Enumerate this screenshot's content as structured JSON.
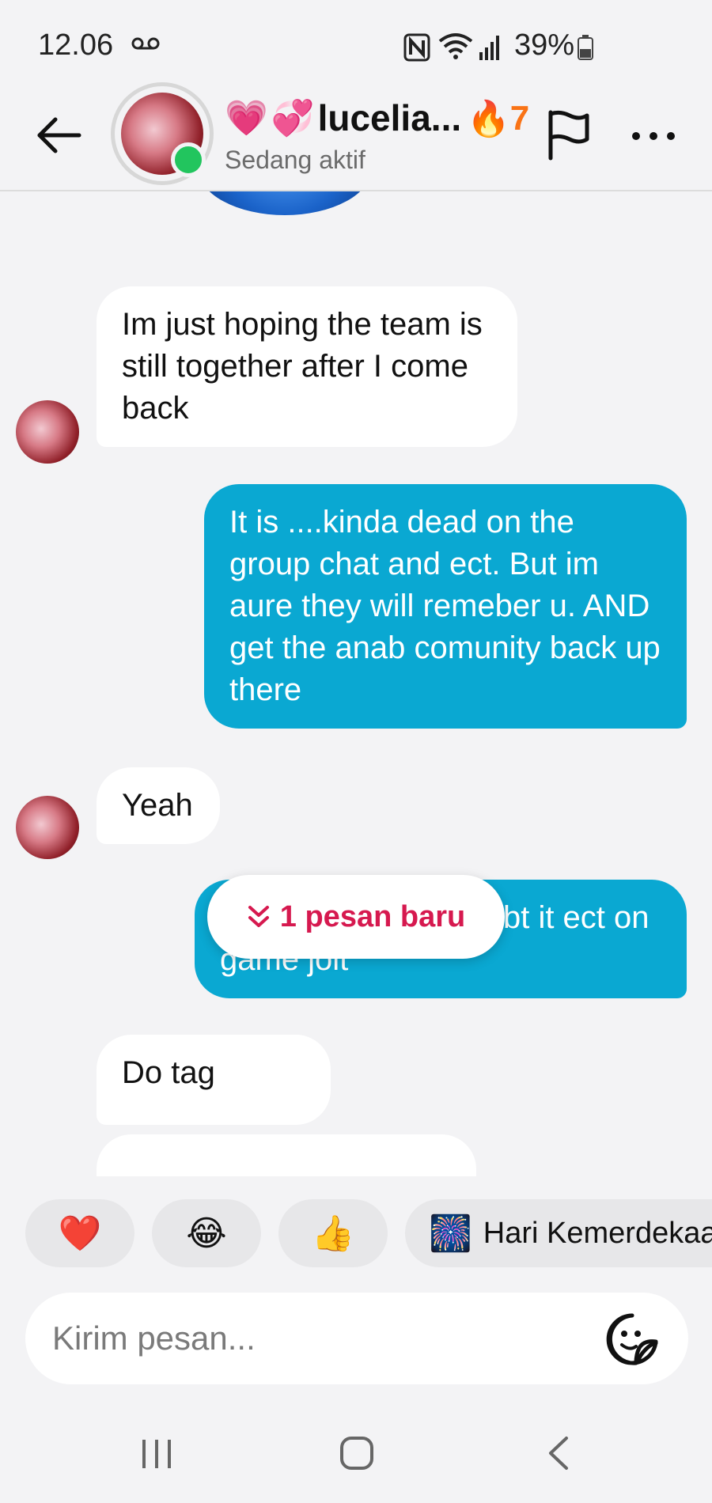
{
  "status_bar": {
    "time": "12.06",
    "battery": "39%",
    "icons": [
      "voicemail-icon",
      "nfc-icon",
      "wifi-icon",
      "signal-icon",
      "battery-icon"
    ]
  },
  "header": {
    "name": "lucelia...",
    "name_emojis": [
      "💗",
      "💞"
    ],
    "streak_icon": "🔥",
    "streak_count": "7",
    "status": "Sedang aktif",
    "icons": [
      "back-arrow-icon",
      "flag-icon",
      "more-icon"
    ]
  },
  "messages": [
    {
      "direction": "in",
      "text": "Im just hoping the team is still together after I come back"
    },
    {
      "direction": "out",
      "text": "It is ....kinda dead on the group chat and ect. But im aure they will remeber u. AND get the anab comunity back up there"
    },
    {
      "direction": "in",
      "text": "Yeah"
    },
    {
      "direction": "out",
      "text": ":3 i can try posting abt it ect on game jolt"
    },
    {
      "direction": "in",
      "text": "Do tag"
    }
  ],
  "new_message_pill": {
    "icon": "double-chevron-down-icon",
    "label": "1 pesan baru",
    "color": "#d6194f"
  },
  "quick_reactions": [
    {
      "emoji": "❤️"
    },
    {
      "emoji": "😂"
    },
    {
      "emoji": "👍"
    },
    {
      "emoji": "🎆",
      "label": "Hari Kemerdekaa"
    }
  ],
  "composer": {
    "placeholder": "Kirim pesan...",
    "value": "",
    "icon": "sticker-icon"
  },
  "colors": {
    "outgoing_bubble": "#0aa8d2",
    "incoming_bubble": "#ffffff",
    "background": "#f3f3f5",
    "online": "#22c55e",
    "streak": "#f97316"
  },
  "nav_bar": {
    "icons": [
      "recent-apps-icon",
      "home-icon",
      "back-icon"
    ]
  }
}
